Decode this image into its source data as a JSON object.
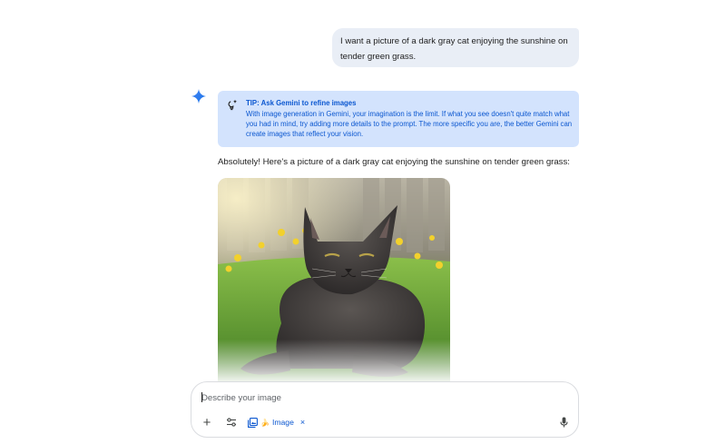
{
  "conversation": {
    "user_message": "I want a picture of a dark gray cat enjoying the sunshine on tender green grass.",
    "tip": {
      "title": "TIP: Ask Gemini to refine images",
      "body": "With image generation in Gemini, your imagination is the limit. If what you see doesn't quite match what you had in mind, try adding more details to the prompt. The more specific you are, the better Gemini can create images that reflect your vision."
    },
    "response_text": "Absolutely! Here's a picture of a dark gray cat enjoying the sunshine on tender green grass:"
  },
  "composer": {
    "placeholder": "Describe your image",
    "value": "",
    "tools": {
      "add_icon": "plus-icon",
      "tune_icon": "tune-icon",
      "chip_icon": "image-gallery-icon",
      "chip_emoji": "🍌",
      "chip_label": "Image",
      "chip_close": "×",
      "mic_icon": "microphone-icon"
    }
  },
  "colors": {
    "accent_blue": "#0b57d0",
    "tip_background": "#d3e3fd",
    "user_bubble": "#e9eef6",
    "sparkle": "#4285f4"
  }
}
